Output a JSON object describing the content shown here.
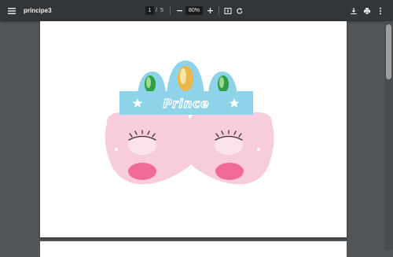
{
  "toolbar": {
    "title": "principe3",
    "current_page": "1",
    "separator": "/",
    "total_pages": "5",
    "zoom": "80%"
  },
  "mask": {
    "crown_text": "Prince"
  },
  "colors": {
    "toolbar_bg": "#323639",
    "viewer_bg": "#525659",
    "crown_band": "#8fd3e8",
    "mask_pink": "#f7cddd",
    "cheek_pink": "#f06a9a"
  },
  "icons": [
    "menu-icon",
    "zoom-out-icon",
    "zoom-in-icon",
    "fit-page-icon",
    "rotate-icon",
    "download-icon",
    "print-icon",
    "more-vert-icon"
  ]
}
